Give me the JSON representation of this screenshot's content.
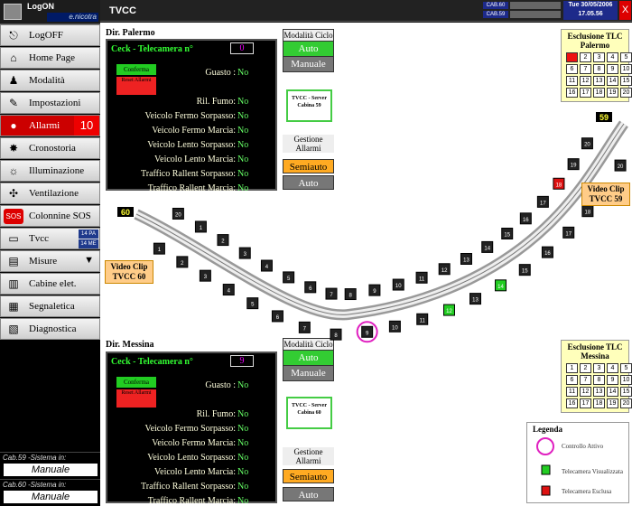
{
  "sidebar": {
    "logon": {
      "title": "LogON",
      "user": "e.nicotra"
    },
    "items": [
      {
        "label": "LogOFF",
        "icon": "logoff-icon",
        "glyph": "⎋"
      },
      {
        "label": "Home Page",
        "icon": "home-icon",
        "glyph": "⌂"
      },
      {
        "label": "Modalità",
        "icon": "mode-icon",
        "glyph": "♟"
      },
      {
        "label": "Impostazioni",
        "icon": "settings-icon",
        "glyph": "✎"
      },
      {
        "label": "Allarmi",
        "icon": "alarm-icon",
        "glyph": "●",
        "badge": "10"
      },
      {
        "label": "Cronostoria",
        "icon": "history-icon",
        "glyph": "✸"
      },
      {
        "label": "Illuminazione",
        "icon": "light-icon",
        "glyph": "☼"
      },
      {
        "label": "Ventilazione",
        "icon": "fan-icon",
        "glyph": "✣"
      },
      {
        "label": "Colonnine SOS",
        "icon": "sos-icon",
        "glyph": "SOS"
      },
      {
        "label": "Tvcc",
        "icon": "tv-icon",
        "glyph": "▭",
        "sub": [
          "14 PA",
          "14 ME"
        ]
      },
      {
        "label": "Misure",
        "icon": "measure-icon",
        "glyph": "▤",
        "arrow": "▼"
      },
      {
        "label": "Cabine elet.",
        "icon": "cabin-icon",
        "glyph": "▥"
      },
      {
        "label": "Segnaletica",
        "icon": "signage-icon",
        "glyph": "▦"
      },
      {
        "label": "Diagnostica",
        "icon": "diagnostic-icon",
        "glyph": "▧"
      }
    ],
    "cab59": {
      "label": "Cab.59 -Sistema in:",
      "value": "Manuale"
    },
    "cab60": {
      "label": "Cab.60 -Sistema in:",
      "value": "Manuale"
    }
  },
  "topbar": {
    "title": "TVCC",
    "cab60": "CAB.60",
    "cab59": "CAB.59",
    "date": "Tue 30/05/2006",
    "time": "17.05.56",
    "close": "X"
  },
  "palermo": {
    "dir": "Dir. Palermo",
    "header": "Ceck - Telecamera n°",
    "camera": "0",
    "confirm": "Conferma",
    "reset": "Reset Allarmi",
    "rows": [
      {
        "label": "Guasto :",
        "value": "No"
      },
      {
        "label": "Ril. Fumo:",
        "value": "No"
      },
      {
        "label": "Veicolo Fermo Sorpasso:",
        "value": "No"
      },
      {
        "label": "Veicolo Fermo Marcia:",
        "value": "No"
      },
      {
        "label": "Veicolo Lento Sorpasso:",
        "value": "No"
      },
      {
        "label": "Veicolo Lento Marcia:",
        "value": "No"
      },
      {
        "label": "Traffico Rallent Sorpasso:",
        "value": "No"
      },
      {
        "label": "Traffico Rallent Marcia:",
        "value": "No"
      }
    ],
    "mode_title": "Modalità Ciclo",
    "auto": "Auto",
    "manuale": "Manuale",
    "server": "TVCC - Server Cabina 59",
    "gest": "Gestione Allarmi",
    "semi": "Semiauto",
    "auto2": "Auto",
    "excl_title": "Esclusione TLC Palermo",
    "excl_red": [
      1
    ]
  },
  "messina": {
    "dir": "Dir. Messina",
    "header": "Ceck - Telecamera n°",
    "camera": "9",
    "confirm": "Conferma",
    "reset": "Reset Allarmi",
    "rows": [
      {
        "label": "Guasto :",
        "value": "No"
      },
      {
        "label": "Ril. Fumo:",
        "value": "No"
      },
      {
        "label": "Veicolo Fermo Sorpasso:",
        "value": "No"
      },
      {
        "label": "Veicolo Fermo Marcia:",
        "value": "No"
      },
      {
        "label": "Veicolo Lento Sorpasso:",
        "value": "No"
      },
      {
        "label": "Veicolo Lento Marcia:",
        "value": "No"
      },
      {
        "label": "Traffico Rallent Sorpasso:",
        "value": "No"
      },
      {
        "label": "Traffico Rallent Marcia:",
        "value": "No"
      }
    ],
    "mode_title": "Modalità Ciclo",
    "auto": "Auto",
    "manuale": "Manuale",
    "server": "TVCC - Server Cabina 60",
    "gest": "Gestione Allarmi",
    "semi": "Semiauto",
    "auto2": "Auto",
    "excl_title": "Esclusione TLC Messina",
    "excl_red": []
  },
  "map": {
    "cam60": "60",
    "cam59": "59",
    "clip60": "Video Clip TVCC 60",
    "clip59": "Video Clip TVCC 59",
    "active_camera": "9",
    "green_cameras": [
      "14",
      "12"
    ],
    "red_cameras": [
      "18"
    ],
    "cameras": [
      "20",
      "1",
      "2",
      "3",
      "4",
      "5",
      "6",
      "7",
      "8",
      "9",
      "10",
      "11",
      "12",
      "13",
      "14",
      "15",
      "16",
      "17",
      "18",
      "19",
      "20",
      "1",
      "2",
      "3",
      "4",
      "5",
      "6",
      "7",
      "8",
      "9",
      "10",
      "11",
      "12",
      "13",
      "14",
      "15",
      "16",
      "17",
      "18",
      "19",
      "20"
    ]
  },
  "legend": {
    "title": "Legenda",
    "items": [
      "Controllo Attivo",
      "Telecamera Visualizzata",
      "Telecamera Esclusa"
    ]
  },
  "colors": {
    "active": "#e020c0",
    "green": "#22cc22",
    "red": "#dd1111"
  }
}
